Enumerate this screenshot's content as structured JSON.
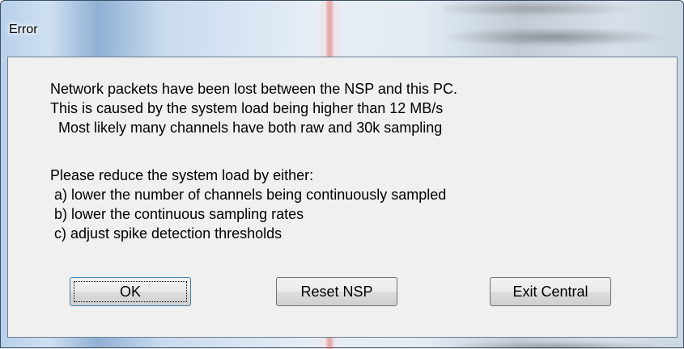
{
  "dialog": {
    "title": "Error",
    "message_lines": [
      "Network packets have been lost between the NSP and this PC.",
      "This is caused by the system load being higher than 12 MB/s",
      "  Most likely many channels have both raw and 30k sampling",
      "",
      "Please reduce the system load by either:",
      " a) lower the number of channels being continuously sampled",
      " b) lower the continuous sampling rates",
      " c) adjust spike detection thresholds"
    ],
    "buttons": {
      "ok": "OK",
      "reset": "Reset NSP",
      "exit": "Exit Central"
    },
    "default_button": "ok"
  }
}
